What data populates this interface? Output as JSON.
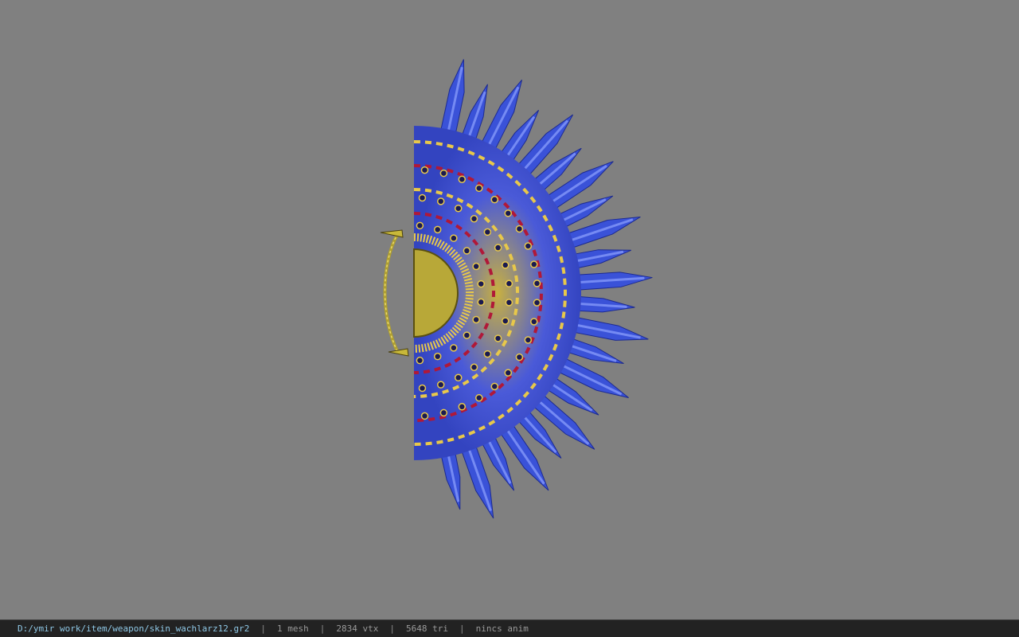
{
  "viewer": {
    "background_color": "#808080",
    "model": {
      "icon": "fan-weapon-model",
      "spike_color": "#3a52d8",
      "spike_highlight": "#8fa3ff",
      "pattern_gold": "#e8c84a",
      "pattern_red": "#b01838",
      "handle_color": "#b0a030"
    }
  },
  "status_bar": {
    "file_path": "D:/ymir work/item/weapon/skin_wachlarz12.gr2",
    "separator": "|",
    "mesh_count": "1 mesh",
    "vertex_count": "2834 vtx",
    "triangle_count": "5648 tri",
    "anim": "nincs anim"
  }
}
